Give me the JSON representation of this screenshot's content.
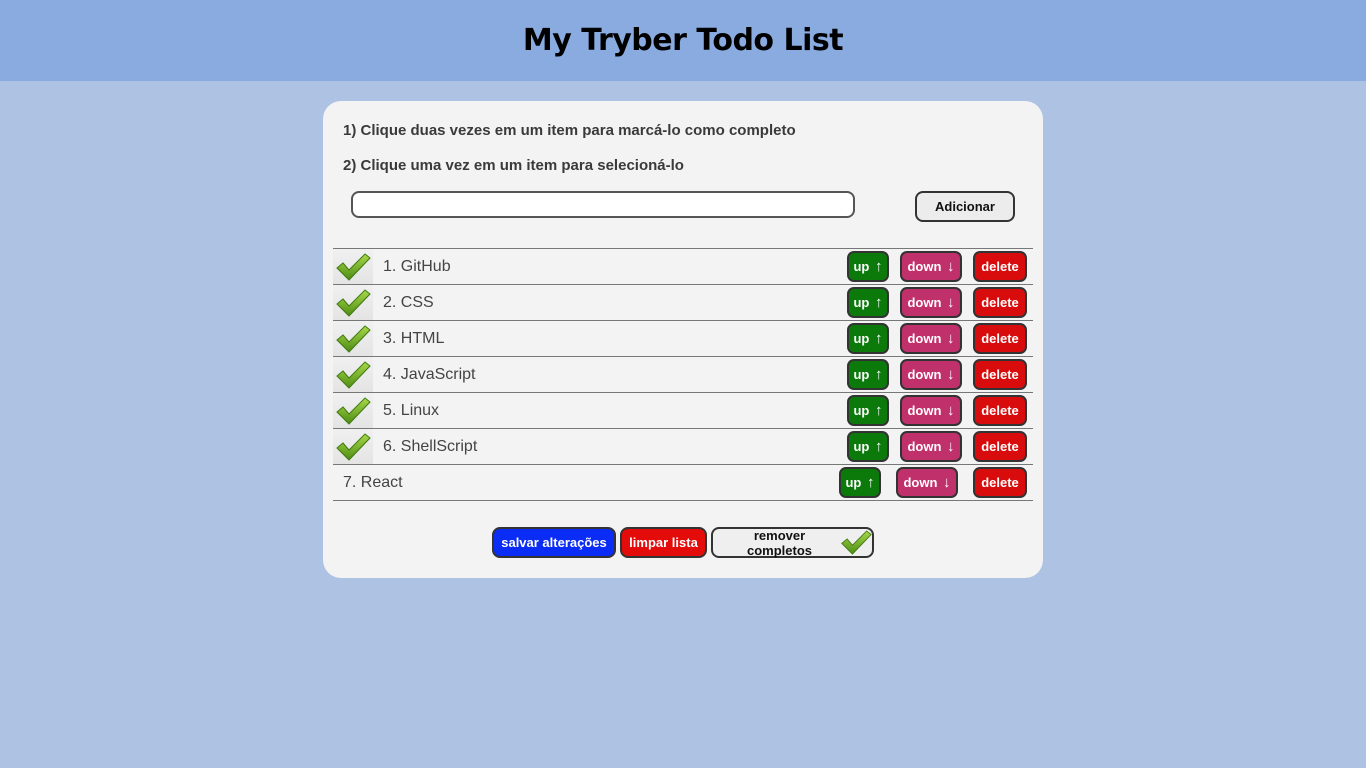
{
  "header": {
    "title": "My Tryber Todo List"
  },
  "instructions": [
    "1) Clique duas vezes em um item para marcá-lo como completo",
    "2) Clique uma vez em um item para selecioná-lo"
  ],
  "input": {
    "value": "",
    "add_label": "Adicionar"
  },
  "items": [
    {
      "label": "1. GitHub",
      "completed": true
    },
    {
      "label": "2. CSS",
      "completed": true
    },
    {
      "label": "3. HTML",
      "completed": true
    },
    {
      "label": "4. JavaScript",
      "completed": true
    },
    {
      "label": "5. Linux",
      "completed": true
    },
    {
      "label": "6. ShellScript",
      "completed": true
    },
    {
      "label": "7. React",
      "completed": false
    }
  ],
  "item_buttons": {
    "up": "up",
    "down": "down",
    "delete": "delete",
    "up_arrow": "↑",
    "down_arrow": "↓"
  },
  "footer": {
    "save_label": "salvar alterações",
    "clear_label": "limpar lista",
    "remove_label": "remover completos"
  },
  "colors": {
    "header_bg": "#89abe0",
    "page_bg": "#aec2e4",
    "card_bg": "#f3f3f3",
    "up_btn": "#0b7a0b",
    "down_btn": "#c0306a",
    "delete_btn": "#d80c0c",
    "save_btn": "#0a2cf5",
    "clear_btn": "#e40b0b"
  }
}
